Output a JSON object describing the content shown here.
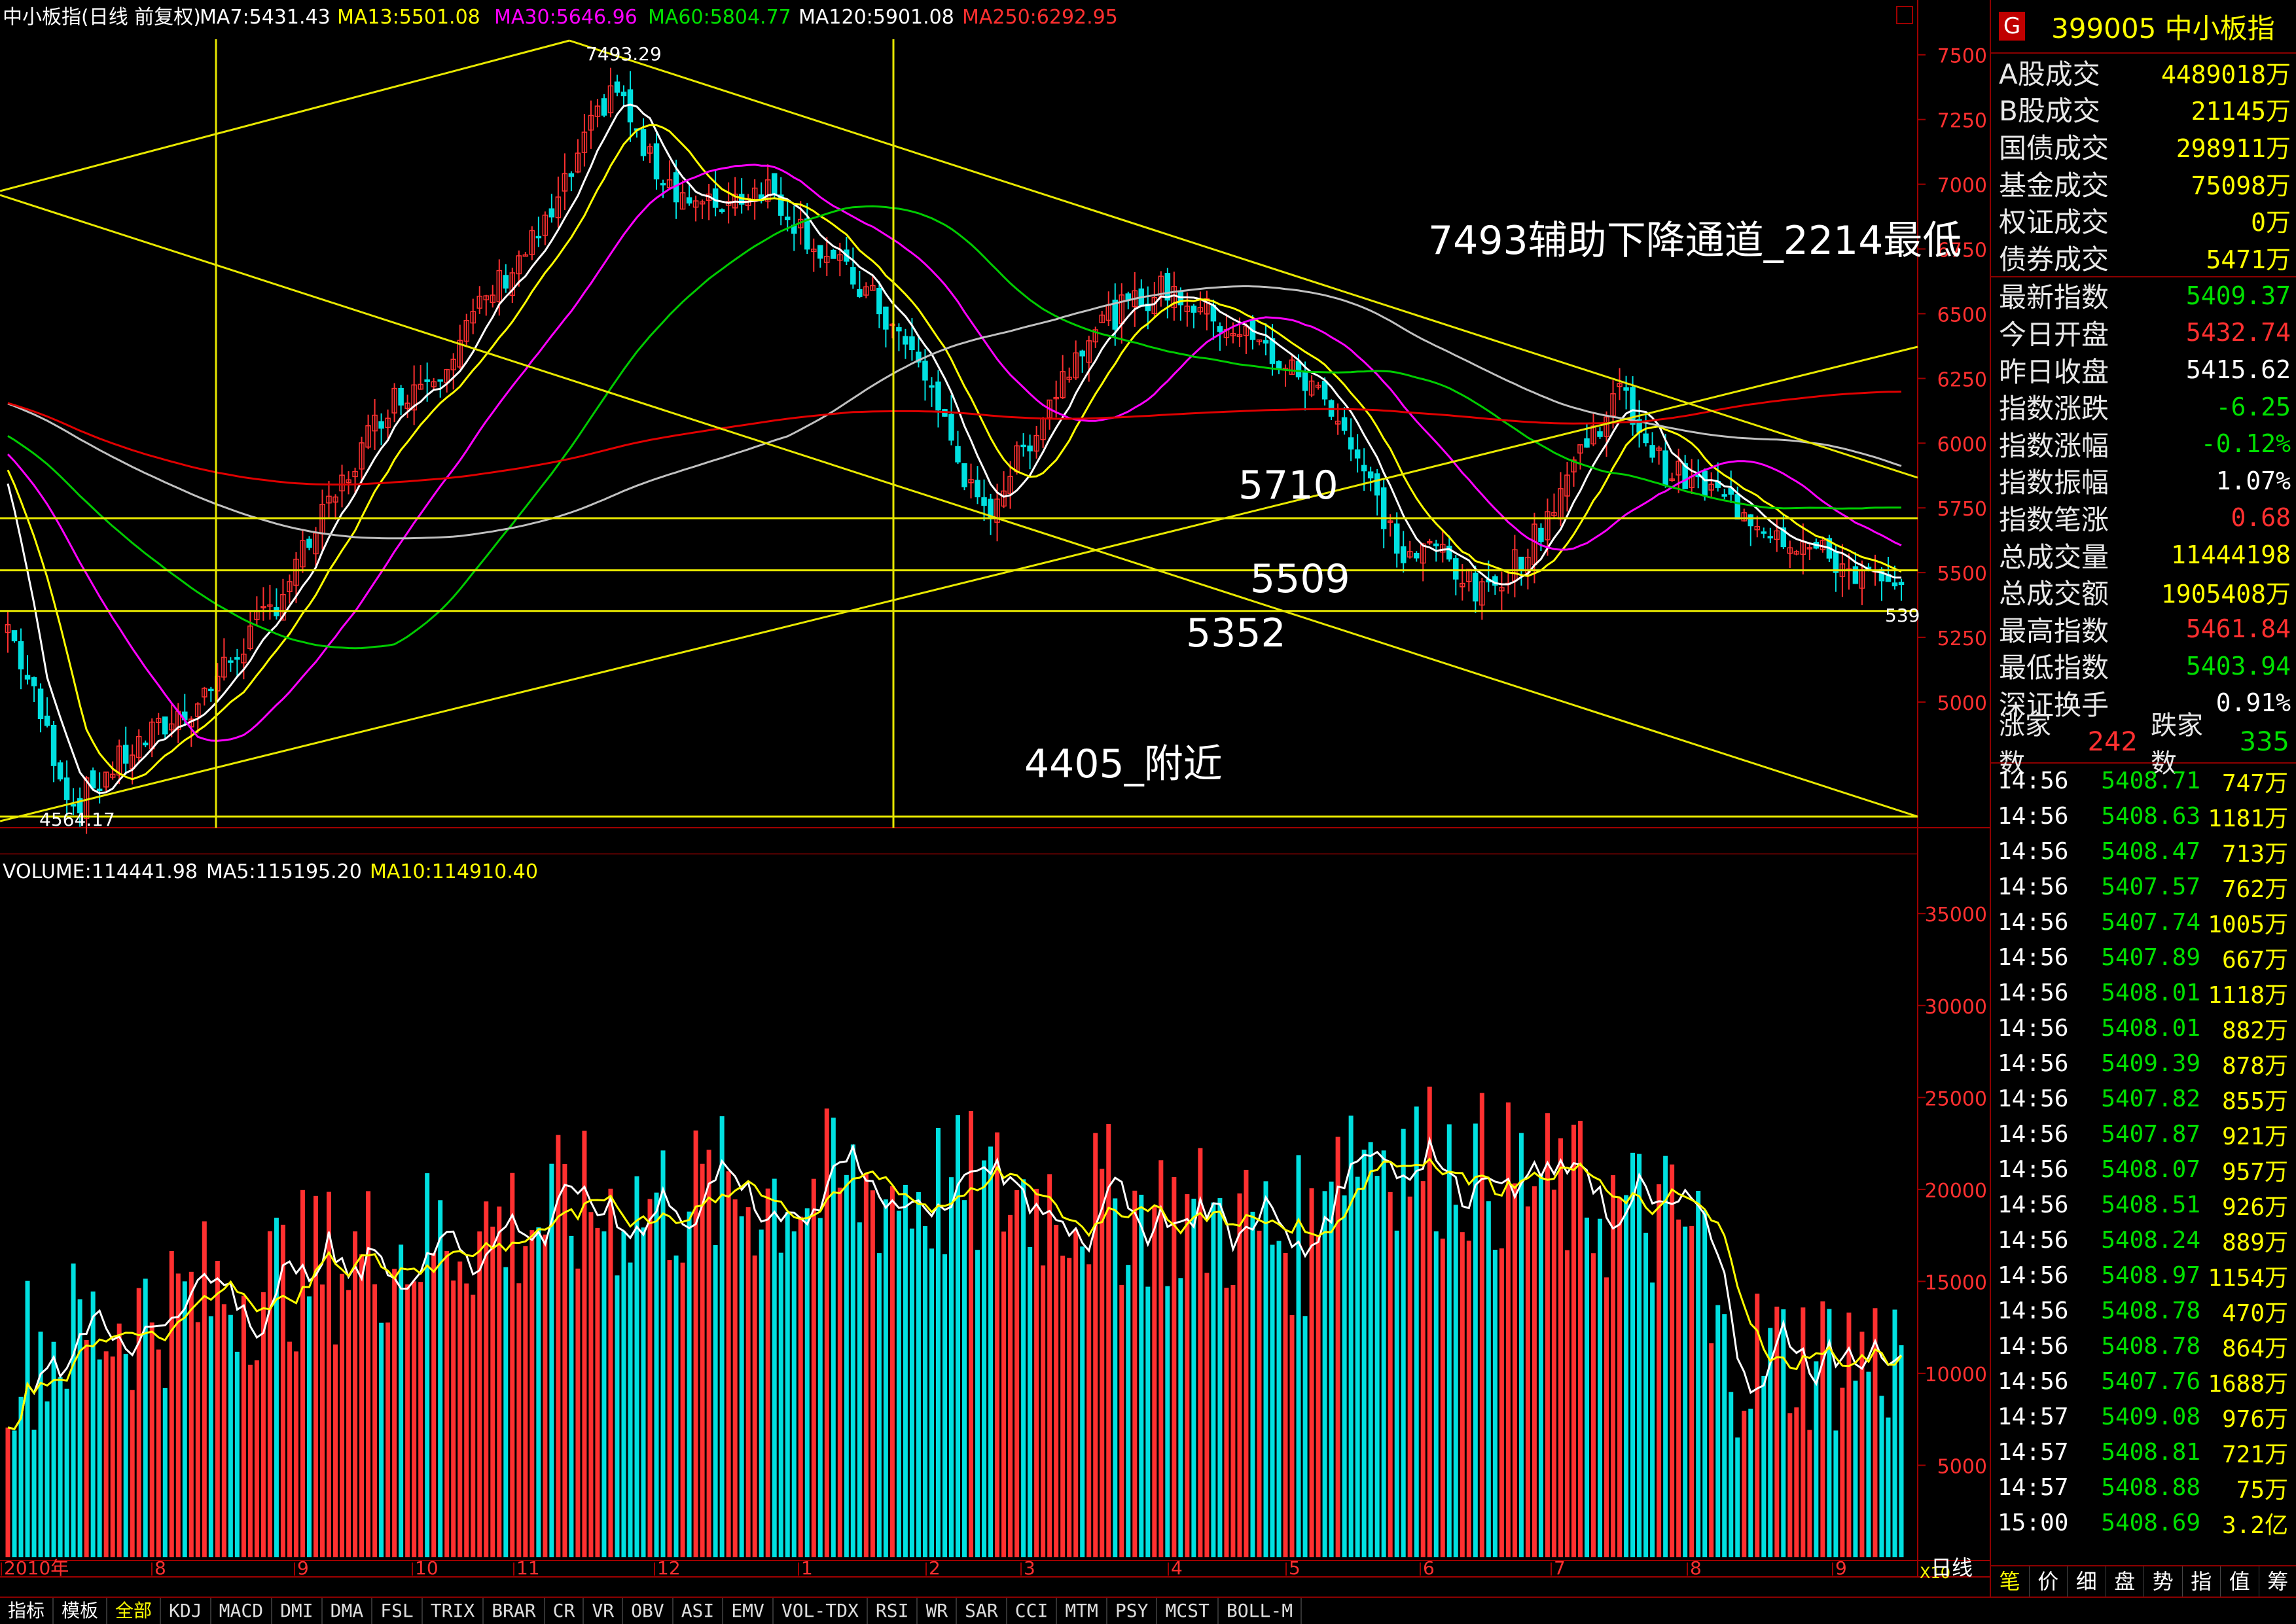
{
  "main_header": {
    "title": "中小板指(日线 前复权)",
    "ma7": "MA7:5431.43",
    "ma13": "MA13:5501.08",
    "ma30": "MA30:5646.96",
    "ma60": "MA60:5804.77",
    "ma120": "MA120:5901.08",
    "ma250": "MA250:6292.95"
  },
  "volume_header": {
    "volume": "VOLUME:114441.98",
    "ma5": "MA5:115195.20",
    "ma10": "MA10:114910.40"
  },
  "colors": {
    "up": "#ff3030",
    "down": "#00e0e0",
    "ma7": "#ffffff",
    "ma13": "#ffff00",
    "ma30": "#ff00ff",
    "ma60": "#00cc00",
    "ma120": "#c0c0c0",
    "ma250": "#e00000",
    "drawing": "#e8e800"
  },
  "annotations": {
    "high": "7493.29",
    "low": "4564.17",
    "channel_text": "7493辅助下降通道_2214最低",
    "level_5710": "5710",
    "level_5509": "5509",
    "level_5352": "5352",
    "target": "4405_附近",
    "last_price_tag": "539"
  },
  "chart_data": [
    {
      "type": "candlestick",
      "title": "中小板指(日线 前复权)",
      "y_ticks": [
        5000,
        5250,
        5500,
        5750,
        6000,
        6250,
        6500,
        6750,
        7000,
        7250,
        7500
      ],
      "ylim": [
        4540,
        7560
      ],
      "x_labels": [
        "2010年",
        "8",
        "9",
        "10",
        "11",
        "12",
        "1",
        "2",
        "3",
        "4",
        "5",
        "6",
        "7",
        "8",
        "9"
      ],
      "high": 7493.29,
      "low": 4564.17,
      "horizontal_levels": [
        5710,
        5509,
        5352
      ],
      "series": [
        {
          "name": "MA7",
          "last": 5431.43
        },
        {
          "name": "MA13",
          "last": 5501.08
        },
        {
          "name": "MA30",
          "last": 5646.96
        },
        {
          "name": "MA60",
          "last": 5804.77
        },
        {
          "name": "MA120",
          "last": 5901.08
        },
        {
          "name": "MA250",
          "last": 6292.95
        }
      ]
    },
    {
      "type": "bar",
      "title": "VOLUME",
      "y_ticks": [
        5000,
        10000,
        15000,
        20000,
        25000,
        30000,
        35000
      ],
      "ylim": [
        0,
        37000
      ],
      "unit_label": "X10",
      "series": [
        {
          "name": "VOLUME",
          "last": 114441.98
        },
        {
          "name": "MA5",
          "last": 115195.2
        },
        {
          "name": "MA10",
          "last": 114910.4
        }
      ]
    }
  ],
  "side": {
    "badge": "G",
    "code_name": "399005 中小板指",
    "stats": [
      {
        "k": "A股成交",
        "v": "4489018万",
        "c": "yellow"
      },
      {
        "k": "B股成交",
        "v": "21145万",
        "c": "yellow"
      },
      {
        "k": "国债成交",
        "v": "298911万",
        "c": "yellow"
      },
      {
        "k": "基金成交",
        "v": "75098万",
        "c": "yellow"
      },
      {
        "k": "权证成交",
        "v": "0万",
        "c": "yellow"
      },
      {
        "k": "债券成交",
        "v": "5471万",
        "c": "yellow"
      },
      {
        "k": "最新指数",
        "v": "5409.37",
        "c": "green"
      },
      {
        "k": "今日开盘",
        "v": "5432.74",
        "c": "red"
      },
      {
        "k": "昨日收盘",
        "v": "5415.62",
        "c": "white"
      },
      {
        "k": "指数涨跌",
        "v": "-6.25",
        "c": "green"
      },
      {
        "k": "指数涨幅",
        "v": "-0.12%",
        "c": "green"
      },
      {
        "k": "指数振幅",
        "v": "1.07%",
        "c": "white"
      },
      {
        "k": "指数笔涨",
        "v": "0.68",
        "c": "red"
      },
      {
        "k": "总成交量",
        "v": "11444198",
        "c": "yellow"
      },
      {
        "k": "总成交额",
        "v": "1905408万",
        "c": "yellow"
      },
      {
        "k": "最高指数",
        "v": "5461.84",
        "c": "red"
      },
      {
        "k": "最低指数",
        "v": "5403.94",
        "c": "green"
      },
      {
        "k": "深证换手",
        "v": "0.91%",
        "c": "white"
      }
    ],
    "rise_label": "涨家数",
    "rise_count": "242",
    "fall_label": "跌家数",
    "fall_count": "335",
    "ticks": [
      {
        "t": "14:56",
        "p": "5408.71",
        "v": "747万"
      },
      {
        "t": "14:56",
        "p": "5408.63",
        "v": "1181万"
      },
      {
        "t": "14:56",
        "p": "5408.47",
        "v": "713万"
      },
      {
        "t": "14:56",
        "p": "5407.57",
        "v": "762万"
      },
      {
        "t": "14:56",
        "p": "5407.74",
        "v": "1005万"
      },
      {
        "t": "14:56",
        "p": "5407.89",
        "v": "667万"
      },
      {
        "t": "14:56",
        "p": "5408.01",
        "v": "1118万"
      },
      {
        "t": "14:56",
        "p": "5408.01",
        "v": "882万"
      },
      {
        "t": "14:56",
        "p": "5409.39",
        "v": "878万"
      },
      {
        "t": "14:56",
        "p": "5407.82",
        "v": "855万"
      },
      {
        "t": "14:56",
        "p": "5407.87",
        "v": "921万"
      },
      {
        "t": "14:56",
        "p": "5408.07",
        "v": "957万"
      },
      {
        "t": "14:56",
        "p": "5408.51",
        "v": "926万"
      },
      {
        "t": "14:56",
        "p": "5408.24",
        "v": "889万"
      },
      {
        "t": "14:56",
        "p": "5408.97",
        "v": "1154万"
      },
      {
        "t": "14:56",
        "p": "5408.78",
        "v": "470万"
      },
      {
        "t": "14:56",
        "p": "5408.78",
        "v": "864万"
      },
      {
        "t": "14:56",
        "p": "5407.76",
        "v": "1688万"
      },
      {
        "t": "14:57",
        "p": "5409.08",
        "v": "976万"
      },
      {
        "t": "14:57",
        "p": "5408.81",
        "v": "721万"
      },
      {
        "t": "14:57",
        "p": "5408.88",
        "v": "75万"
      },
      {
        "t": "15:00",
        "p": "5408.69",
        "v": "3.2亿"
      }
    ],
    "tabs": [
      "笔",
      "价",
      "细",
      "盘",
      "势",
      "指",
      "值",
      "筹"
    ]
  },
  "period_label": "日线",
  "bottom_tabs": [
    "指标",
    "模板",
    "全部",
    "KDJ",
    "MACD",
    "DMI",
    "DMA",
    "FSL",
    "TRIX",
    "BRAR",
    "CR",
    "VR",
    "OBV",
    "ASI",
    "EMV",
    "VOL-TDX",
    "RSI",
    "WR",
    "SAR",
    "CCI",
    "MTM",
    "PSY",
    "MCST",
    "BOLL-M"
  ]
}
